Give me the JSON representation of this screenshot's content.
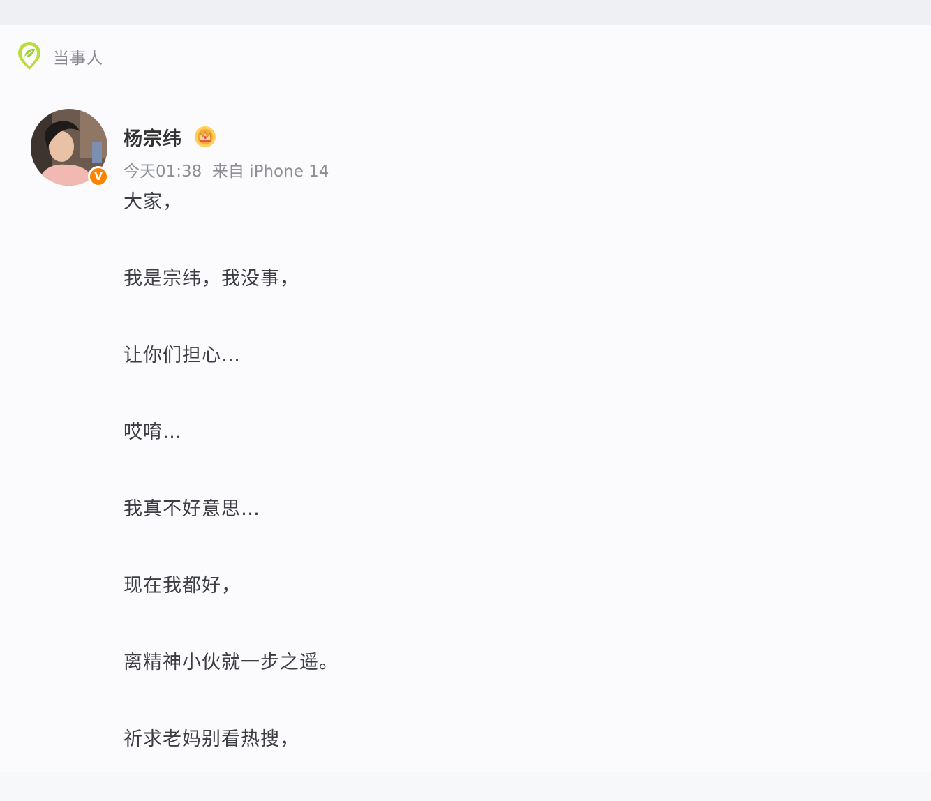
{
  "section": {
    "title": "当事人",
    "icon": "leaf-pin-icon"
  },
  "post": {
    "author": "杨宗纬",
    "author_badge_icon": "crown-icon",
    "verified_icon": "verified-badge-icon",
    "verified_mark": "V",
    "meta": "今天01:38  来自 iPhone 14",
    "lines": [
      "大家，",
      "我是宗纬，我没事，",
      "让你们担心…",
      "哎唷…",
      "我真不好意思…",
      "现在我都好，",
      "离精神小伙就一步之遥。",
      "祈求老妈别看热搜，"
    ]
  },
  "colors": {
    "verified": "#ff8200",
    "leaf_icon": "#9acd32",
    "text_primary": "#333333",
    "text_muted": "#8c8f94"
  }
}
